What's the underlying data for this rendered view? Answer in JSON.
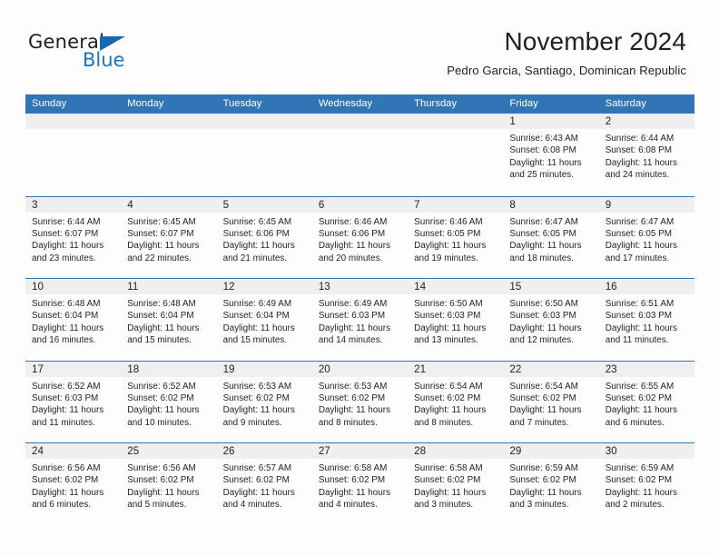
{
  "brand": {
    "name_part1": "General",
    "name_part2": "Blue"
  },
  "header": {
    "title": "November 2024",
    "subtitle": "Pedro Garcia, Santiago, Dominican Republic"
  },
  "colors": {
    "header_blue": "#3275b6",
    "brand_blue": "#1b75bc",
    "day_number_bg": "#efefef",
    "text": "#231f20"
  },
  "weekdays": [
    "Sunday",
    "Monday",
    "Tuesday",
    "Wednesday",
    "Thursday",
    "Friday",
    "Saturday"
  ],
  "labels": {
    "sunrise_prefix": "Sunrise:",
    "sunset_prefix": "Sunset:",
    "daylight_prefix": "Daylight:"
  },
  "weeks": [
    [
      {
        "day": "",
        "sunrise": "",
        "sunset": "",
        "daylight": "",
        "empty": true
      },
      {
        "day": "",
        "sunrise": "",
        "sunset": "",
        "daylight": "",
        "empty": true
      },
      {
        "day": "",
        "sunrise": "",
        "sunset": "",
        "daylight": "",
        "empty": true
      },
      {
        "day": "",
        "sunrise": "",
        "sunset": "",
        "daylight": "",
        "empty": true
      },
      {
        "day": "",
        "sunrise": "",
        "sunset": "",
        "daylight": "",
        "empty": true
      },
      {
        "day": "1",
        "sunrise": "Sunrise: 6:43 AM",
        "sunset": "Sunset: 6:08 PM",
        "daylight": "Daylight: 11 hours and 25 minutes."
      },
      {
        "day": "2",
        "sunrise": "Sunrise: 6:44 AM",
        "sunset": "Sunset: 6:08 PM",
        "daylight": "Daylight: 11 hours and 24 minutes."
      }
    ],
    [
      {
        "day": "3",
        "sunrise": "Sunrise: 6:44 AM",
        "sunset": "Sunset: 6:07 PM",
        "daylight": "Daylight: 11 hours and 23 minutes."
      },
      {
        "day": "4",
        "sunrise": "Sunrise: 6:45 AM",
        "sunset": "Sunset: 6:07 PM",
        "daylight": "Daylight: 11 hours and 22 minutes."
      },
      {
        "day": "5",
        "sunrise": "Sunrise: 6:45 AM",
        "sunset": "Sunset: 6:06 PM",
        "daylight": "Daylight: 11 hours and 21 minutes."
      },
      {
        "day": "6",
        "sunrise": "Sunrise: 6:46 AM",
        "sunset": "Sunset: 6:06 PM",
        "daylight": "Daylight: 11 hours and 20 minutes."
      },
      {
        "day": "7",
        "sunrise": "Sunrise: 6:46 AM",
        "sunset": "Sunset: 6:05 PM",
        "daylight": "Daylight: 11 hours and 19 minutes."
      },
      {
        "day": "8",
        "sunrise": "Sunrise: 6:47 AM",
        "sunset": "Sunset: 6:05 PM",
        "daylight": "Daylight: 11 hours and 18 minutes."
      },
      {
        "day": "9",
        "sunrise": "Sunrise: 6:47 AM",
        "sunset": "Sunset: 6:05 PM",
        "daylight": "Daylight: 11 hours and 17 minutes."
      }
    ],
    [
      {
        "day": "10",
        "sunrise": "Sunrise: 6:48 AM",
        "sunset": "Sunset: 6:04 PM",
        "daylight": "Daylight: 11 hours and 16 minutes."
      },
      {
        "day": "11",
        "sunrise": "Sunrise: 6:48 AM",
        "sunset": "Sunset: 6:04 PM",
        "daylight": "Daylight: 11 hours and 15 minutes."
      },
      {
        "day": "12",
        "sunrise": "Sunrise: 6:49 AM",
        "sunset": "Sunset: 6:04 PM",
        "daylight": "Daylight: 11 hours and 15 minutes."
      },
      {
        "day": "13",
        "sunrise": "Sunrise: 6:49 AM",
        "sunset": "Sunset: 6:03 PM",
        "daylight": "Daylight: 11 hours and 14 minutes."
      },
      {
        "day": "14",
        "sunrise": "Sunrise: 6:50 AM",
        "sunset": "Sunset: 6:03 PM",
        "daylight": "Daylight: 11 hours and 13 minutes."
      },
      {
        "day": "15",
        "sunrise": "Sunrise: 6:50 AM",
        "sunset": "Sunset: 6:03 PM",
        "daylight": "Daylight: 11 hours and 12 minutes."
      },
      {
        "day": "16",
        "sunrise": "Sunrise: 6:51 AM",
        "sunset": "Sunset: 6:03 PM",
        "daylight": "Daylight: 11 hours and 11 minutes."
      }
    ],
    [
      {
        "day": "17",
        "sunrise": "Sunrise: 6:52 AM",
        "sunset": "Sunset: 6:03 PM",
        "daylight": "Daylight: 11 hours and 11 minutes."
      },
      {
        "day": "18",
        "sunrise": "Sunrise: 6:52 AM",
        "sunset": "Sunset: 6:02 PM",
        "daylight": "Daylight: 11 hours and 10 minutes."
      },
      {
        "day": "19",
        "sunrise": "Sunrise: 6:53 AM",
        "sunset": "Sunset: 6:02 PM",
        "daylight": "Daylight: 11 hours and 9 minutes."
      },
      {
        "day": "20",
        "sunrise": "Sunrise: 6:53 AM",
        "sunset": "Sunset: 6:02 PM",
        "daylight": "Daylight: 11 hours and 8 minutes."
      },
      {
        "day": "21",
        "sunrise": "Sunrise: 6:54 AM",
        "sunset": "Sunset: 6:02 PM",
        "daylight": "Daylight: 11 hours and 8 minutes."
      },
      {
        "day": "22",
        "sunrise": "Sunrise: 6:54 AM",
        "sunset": "Sunset: 6:02 PM",
        "daylight": "Daylight: 11 hours and 7 minutes."
      },
      {
        "day": "23",
        "sunrise": "Sunrise: 6:55 AM",
        "sunset": "Sunset: 6:02 PM",
        "daylight": "Daylight: 11 hours and 6 minutes."
      }
    ],
    [
      {
        "day": "24",
        "sunrise": "Sunrise: 6:56 AM",
        "sunset": "Sunset: 6:02 PM",
        "daylight": "Daylight: 11 hours and 6 minutes."
      },
      {
        "day": "25",
        "sunrise": "Sunrise: 6:56 AM",
        "sunset": "Sunset: 6:02 PM",
        "daylight": "Daylight: 11 hours and 5 minutes."
      },
      {
        "day": "26",
        "sunrise": "Sunrise: 6:57 AM",
        "sunset": "Sunset: 6:02 PM",
        "daylight": "Daylight: 11 hours and 4 minutes."
      },
      {
        "day": "27",
        "sunrise": "Sunrise: 6:58 AM",
        "sunset": "Sunset: 6:02 PM",
        "daylight": "Daylight: 11 hours and 4 minutes."
      },
      {
        "day": "28",
        "sunrise": "Sunrise: 6:58 AM",
        "sunset": "Sunset: 6:02 PM",
        "daylight": "Daylight: 11 hours and 3 minutes."
      },
      {
        "day": "29",
        "sunrise": "Sunrise: 6:59 AM",
        "sunset": "Sunset: 6:02 PM",
        "daylight": "Daylight: 11 hours and 3 minutes."
      },
      {
        "day": "30",
        "sunrise": "Sunrise: 6:59 AM",
        "sunset": "Sunset: 6:02 PM",
        "daylight": "Daylight: 11 hours and 2 minutes."
      }
    ]
  ]
}
